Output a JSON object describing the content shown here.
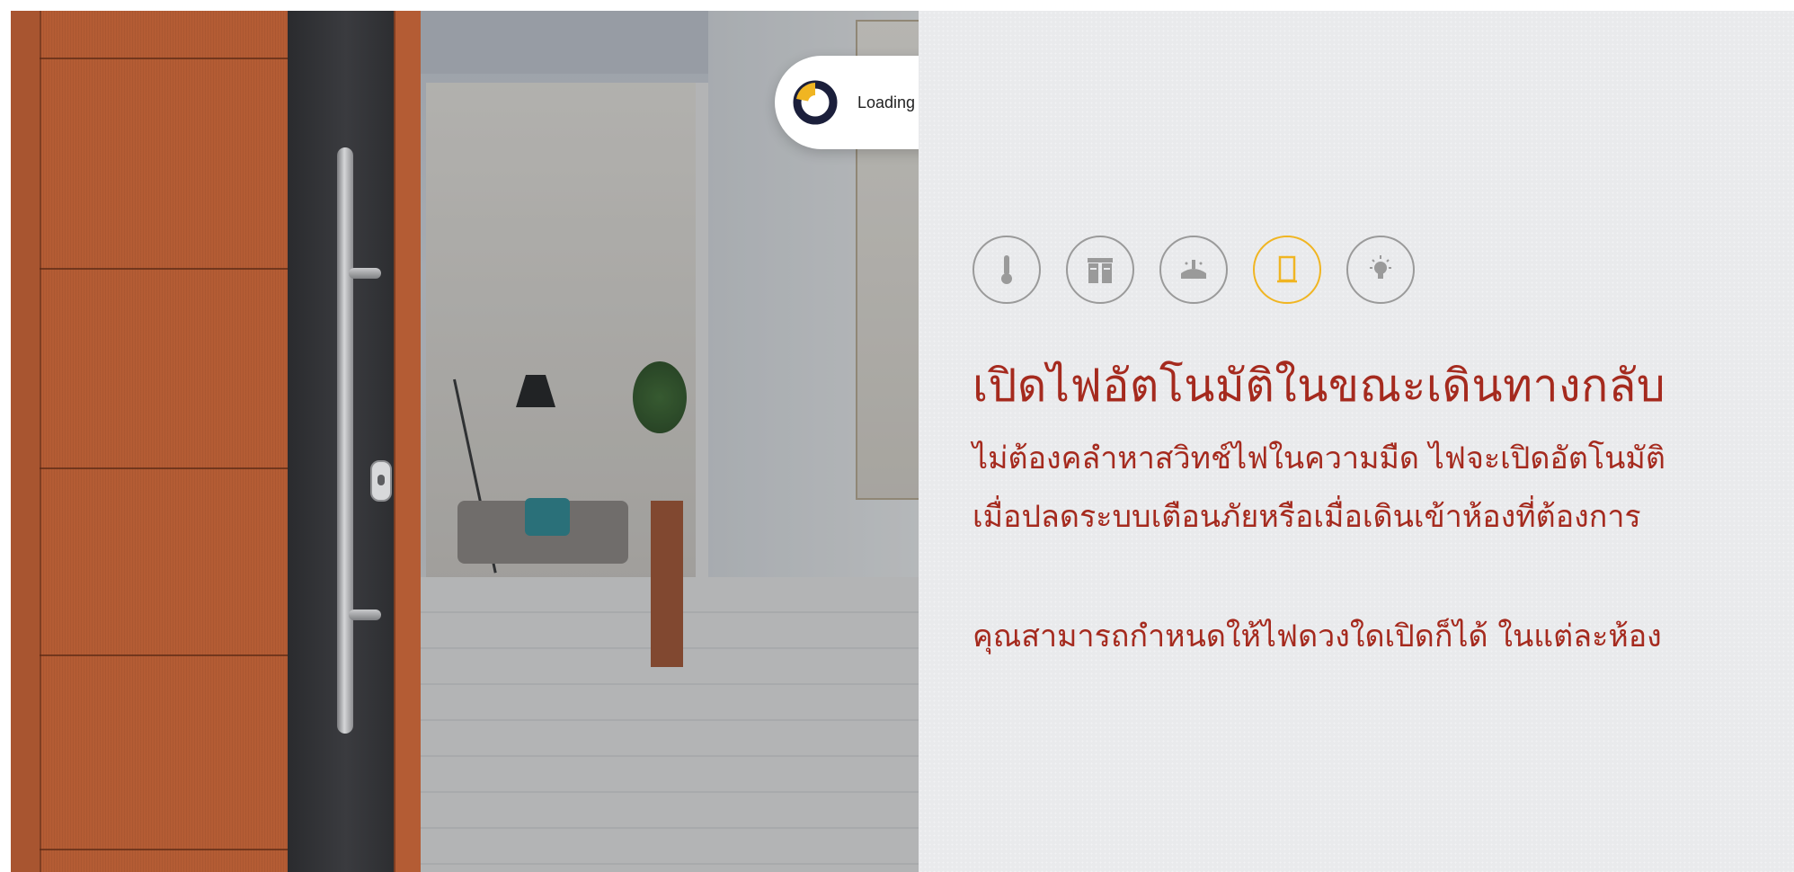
{
  "loading": {
    "label": "Loading animation"
  },
  "photo": {
    "alt": "door-handle-hallway-photo"
  },
  "features": {
    "icons": [
      {
        "name": "thermometer-icon",
        "active": false
      },
      {
        "name": "curtain-icon",
        "active": false
      },
      {
        "name": "sprinkler-icon",
        "active": false
      },
      {
        "name": "door-icon",
        "active": true
      },
      {
        "name": "light-bulb-icon",
        "active": false
      }
    ],
    "active_color": "#f0b522",
    "inactive_color": "#9a9a9a"
  },
  "main": {
    "headline": "เปิดไฟอัตโนมัติในขณะเดินทางกลับ",
    "description_line1": "ไม่ต้องคลำหาสวิทช์ไฟในความมืด ไฟจะเปิดอัตโนมัติ",
    "description_line2": "เมื่อปลดระบบเตือนภัยหรือเมื่อเดินเข้าห้องที่ต้องการ",
    "description_line3": "คุณสามารถกำหนดให้ไฟดวงใดเปิดก็ได้ ในแต่ละห้อง"
  },
  "colors": {
    "text_accent": "#a52a1e",
    "panel_bg": "#e9eaec",
    "door_wood": "#b45c34"
  }
}
